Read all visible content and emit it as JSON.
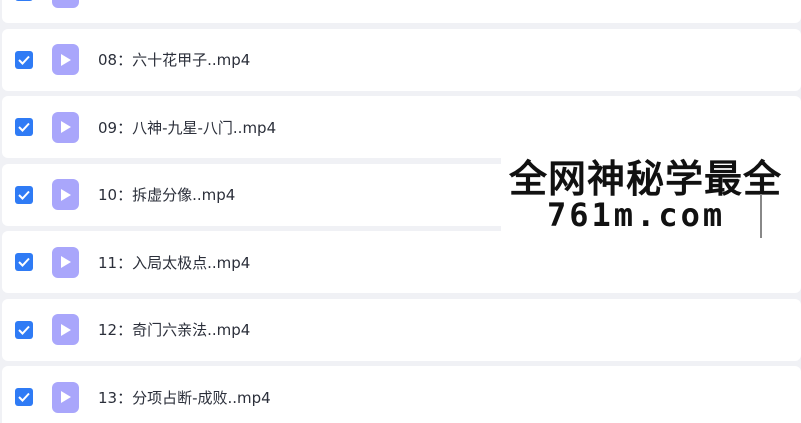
{
  "files": [
    {
      "name": ""
    },
    {
      "name": "08：六十花甲子..mp4"
    },
    {
      "name": "09：八神-九星-八门..mp4"
    },
    {
      "name": "10：拆虚分像..mp4"
    },
    {
      "name": "11：入局太极点..mp4"
    },
    {
      "name": "12：奇门六亲法..mp4"
    },
    {
      "name": "13：分项占断-成败..mp4"
    }
  ],
  "watermark": {
    "line1": "全网神秘学最全",
    "line2": "761m.com"
  },
  "colors": {
    "checkbox": "#2f7bf5",
    "file_icon": "#a9a6fb",
    "row_bg": "#ffffff",
    "page_bg": "#f0f1f5"
  },
  "icons": {
    "checkbox": "checkmark-icon",
    "file": "video-file-icon"
  }
}
